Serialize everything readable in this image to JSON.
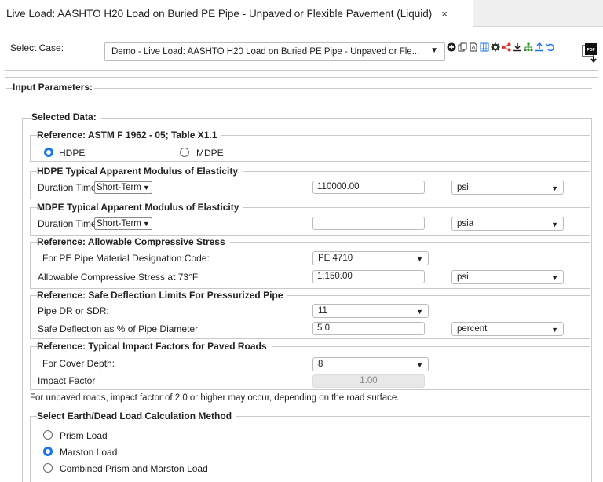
{
  "tab": {
    "title": "Live Load: AASHTO H20 Load on Buried PE Pipe - Unpaved or Flexible Pavement (Liquid)",
    "close": "×"
  },
  "case": {
    "label": "Select Case:",
    "value": "Demo - Live Load: AASHTO H20 Load on Buried PE Pipe - Unpaved or Fle..."
  },
  "toolbar": {
    "icons": [
      "plus-icon",
      "copy-icon",
      "pdf-doc-icon",
      "table-icon",
      "gear-icon",
      "share-icon",
      "download-icon",
      "hierarchy-icon",
      "upload-icon",
      "undo-icon"
    ],
    "accent_green": "#2e8b2e",
    "accent_red": "#d9342b",
    "accent_blue": "#1a73e8"
  },
  "input_parameters": {
    "title": "Input Parameters:"
  },
  "selected_data": {
    "title": "Selected Data:"
  },
  "astm": {
    "title": "Reference: ASTM F 1962 - 05; Table X1.1",
    "opt1": "HDPE",
    "opt2": "MDPE",
    "selected": "HDPE"
  },
  "hdpe": {
    "title": "HDPE Typical Apparent Modulus of Elasticity",
    "duration_label": "Duration Time",
    "duration_value": "Short-Term",
    "value": "110000.00",
    "unit": "psi"
  },
  "mdpe": {
    "title": "MDPE Typical Apparent Modulus of Elasticity",
    "duration_label": "Duration Time",
    "duration_value": "Short-Term",
    "value": "",
    "unit": "psia"
  },
  "compressive": {
    "title": "Reference: Allowable Compressive Stress",
    "code_label": "For PE Pipe Material Designation Code:",
    "code_value": "PE 4710",
    "stress_label": "Allowable Compressive Stress at 73°F",
    "stress_value": "1,150.00",
    "stress_unit": "psi"
  },
  "deflection": {
    "title": "Reference: Safe Deflection Limits For Pressurized Pipe",
    "dr_label": "Pipe DR or SDR:",
    "dr_value": "11",
    "safe_label": "Safe Deflection as % of Pipe Diameter",
    "safe_value": "5.0",
    "safe_unit": "percent"
  },
  "impact": {
    "title": "Reference: Typical Impact Factors for Paved Roads",
    "cover_label": "For Cover Depth:",
    "cover_value": "8",
    "factor_label": "Impact Factor",
    "factor_value": "1.00"
  },
  "note": "For unpaved roads, impact factor of 2.0 or higher may occur, depending on the road surface.",
  "earth": {
    "title": "Select Earth/Dead Load Calculation Method",
    "opt1": "Prism Load",
    "opt2": "Marston Load",
    "opt3": "Combined Prism and Marston Load",
    "selected": "Marston Load"
  }
}
